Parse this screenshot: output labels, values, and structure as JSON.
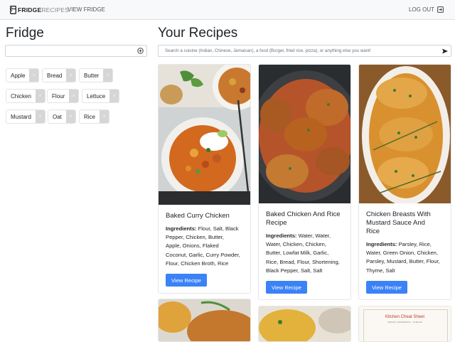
{
  "nav": {
    "brand_bold": "FRIDGE",
    "brand_light": "RECIPES",
    "view_fridge": "VIEW FRIDGE",
    "logout": "LOG OUT"
  },
  "fridge": {
    "title": "Fridge",
    "input_value": "",
    "chips": [
      {
        "label": "Apple"
      },
      {
        "label": "Bread"
      },
      {
        "label": "Butter"
      },
      {
        "label": "Chicken"
      },
      {
        "label": "Flour"
      },
      {
        "label": "Lettuce"
      },
      {
        "label": "Mustard"
      },
      {
        "label": "Oat"
      },
      {
        "label": "Rice"
      }
    ],
    "remove_glyph": "×"
  },
  "recipes": {
    "title": "Your Recipes",
    "search_placeholder": "Search a cuisine (Indian, Chinese, Jamaican), a food (Burger, fried rice, pizza), or anything else you want!",
    "ingredients_label": "Ingredients:",
    "button_label": "View Recipe",
    "cards": [
      {
        "title": "Baked Curry Chicken",
        "ingredients_lines": [
          "Flour, Salt, Black",
          "Pepper, Chicken, Butter,",
          "Apple, Onions, Flaked",
          "Coconut, Garlic, Curry Powder,",
          "Flour, Chicken Broth, Rice"
        ]
      },
      {
        "title_lines": [
          "Baked Chicken And Rice",
          "Recipe"
        ],
        "ingredients_lines": [
          "Water, Water,",
          "Water, Chicken, Chicken,",
          "Butter, Lowfat Milk, Garlic,",
          "Rice, Bread, Flour, Shortening,",
          "Black Pepper, Salt, Salt"
        ]
      },
      {
        "title_lines": [
          "Chicken Breasts With",
          "Mustard Sauce And",
          "Rice"
        ],
        "ingredients_lines": [
          "Parsley, Rice,",
          "Water, Green Onion, Chicken,",
          "Parsley, Mustard, Butter, Flour,",
          "Thyme, Salt"
        ]
      }
    ],
    "partial_sheet_title": "Kitchen Cheat Sheet",
    "partial_sheet_sub": "METRIC CONVERSION · SCIENCE"
  },
  "colors": {
    "accent": "#3b82f6",
    "navbar": "#f8f9fa",
    "chip_remove": "#d6d6d6"
  }
}
